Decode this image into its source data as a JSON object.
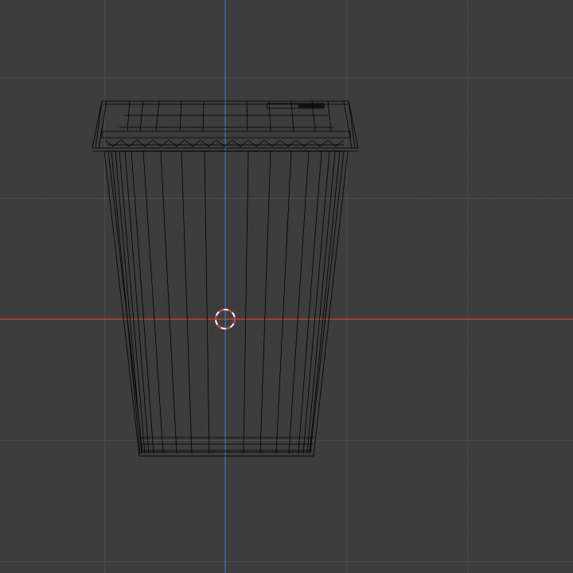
{
  "viewport": {
    "background_color": "#3d3d3d",
    "grid_minor_color": "#353535",
    "grid_major_color": "#4a4a4a"
  },
  "axes": {
    "x_axis_color": "#d03b3b",
    "z_axis_color": "#3f6fb0"
  },
  "object": {
    "type": "paper-cup-with-lid",
    "display_mode": "wireframe",
    "wire_color": "#000000"
  },
  "cursor": {
    "icon": "3d-cursor-icon",
    "ring_colors": [
      "#ffffff",
      "#d03b3b"
    ]
  }
}
